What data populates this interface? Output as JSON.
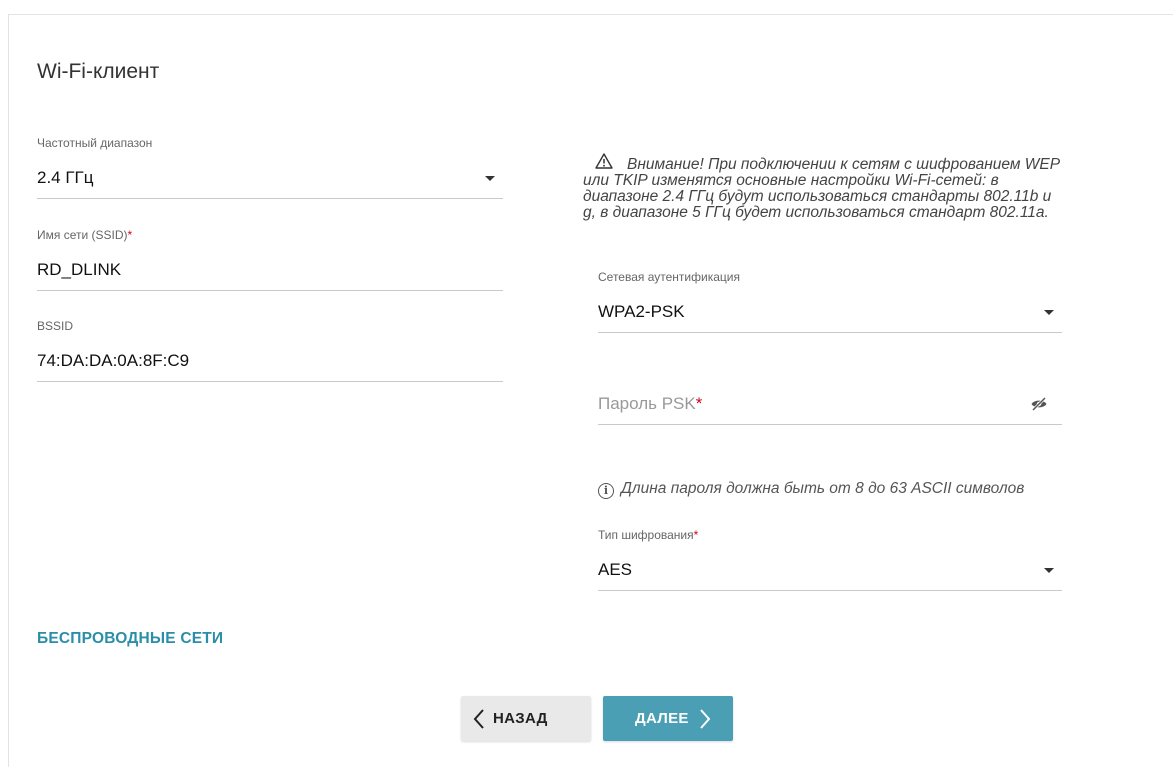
{
  "page": {
    "title": "Wi-Fi-клиент"
  },
  "left": {
    "band": {
      "label": "Частотный диапазон",
      "value": "2.4 ГГц"
    },
    "ssid": {
      "label": "Имя сети (SSID)",
      "required": "*",
      "value": "RD_DLINK"
    },
    "bssid": {
      "label": "BSSID",
      "value": "74:DA:DA:0A:8F:C9"
    }
  },
  "right": {
    "warning": {
      "icon": "warning-icon",
      "text": "Внимание! При подключении к сетям с шифрованием WEP или TKIP изменятся основные настройки Wi-Fi-сетей: в диапазоне 2.4 ГГц будут использоваться стандарты 802.11b и g, в диапазоне 5 ГГц будет использоваться стандарт 802.11a."
    },
    "auth": {
      "label": "Сетевая аутентификация",
      "value": "WPA2-PSK"
    },
    "psk": {
      "placeholder": "Пароль PSK",
      "required": "*",
      "icon": "eye-off-icon"
    },
    "hint": {
      "icon": "info-icon",
      "text": "Длина пароля должна быть от 8 до 63 ASCII символов"
    },
    "cipher": {
      "label": "Тип шифрования",
      "required": "*",
      "value": "AES"
    }
  },
  "links": {
    "wireless": "БЕСПРОВОДНЫЕ СЕТИ"
  },
  "buttons": {
    "back": "НАЗАД",
    "next": "ДАЛЕЕ"
  }
}
